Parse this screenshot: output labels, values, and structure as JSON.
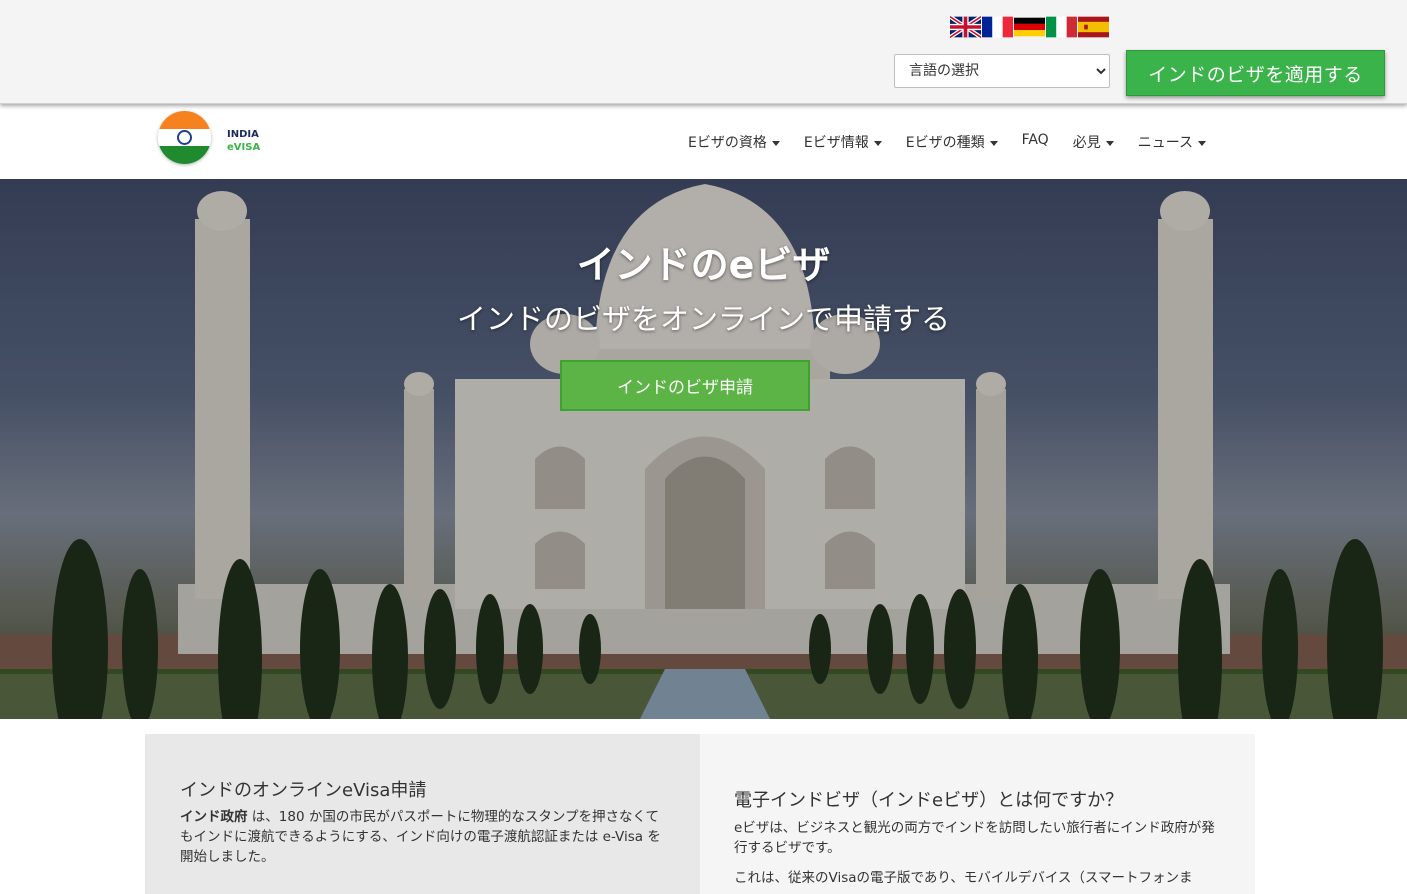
{
  "topbar": {
    "flags": [
      {
        "name": "uk-flag-icon"
      },
      {
        "name": "france-flag-icon"
      },
      {
        "name": "germany-flag-icon"
      },
      {
        "name": "italy-flag-icon"
      },
      {
        "name": "spain-flag-icon"
      }
    ],
    "language_select": {
      "selected": "言語の選択"
    },
    "apply_button": "インドのビザを適用する"
  },
  "logo": {
    "line1": "INDIA",
    "line2": "eVISA"
  },
  "nav": {
    "items": [
      {
        "label": "Eビザの資格",
        "dropdown": true
      },
      {
        "label": "Eビザ情報",
        "dropdown": true
      },
      {
        "label": "Eビザの種類",
        "dropdown": true
      },
      {
        "label": "FAQ",
        "dropdown": false
      },
      {
        "label": "必見",
        "dropdown": true
      },
      {
        "label": "ニュース",
        "dropdown": true
      }
    ]
  },
  "hero": {
    "title": "インドのeビザ",
    "subtitle": "インドのビザをオンラインで申請する",
    "button": "インドのビザ申請"
  },
  "content": {
    "left": {
      "heading": "インドのオンラインeVisa申請",
      "bold_lead": "インド政府",
      "text": " は、180 か国の市民がパスポートに物理的なスタンプを押さなくてもインドに渡航できるようにする、インド向けの電子渡航認証または e-Visa を開始しました。"
    },
    "right": {
      "heading": "電子インドビザ（インドeビザ）とは何ですか？",
      "para1": "eビザは、ビジネスと観光の両方でインドを訪問したい旅行者にインド政府が発行するビザです。",
      "para2": "これは、従来のVisaの電子版であり、モバイルデバイス（スマートフォンま"
    }
  },
  "colors": {
    "accent_green": "#3ab34a",
    "hero_button_green": "#5cb346"
  }
}
